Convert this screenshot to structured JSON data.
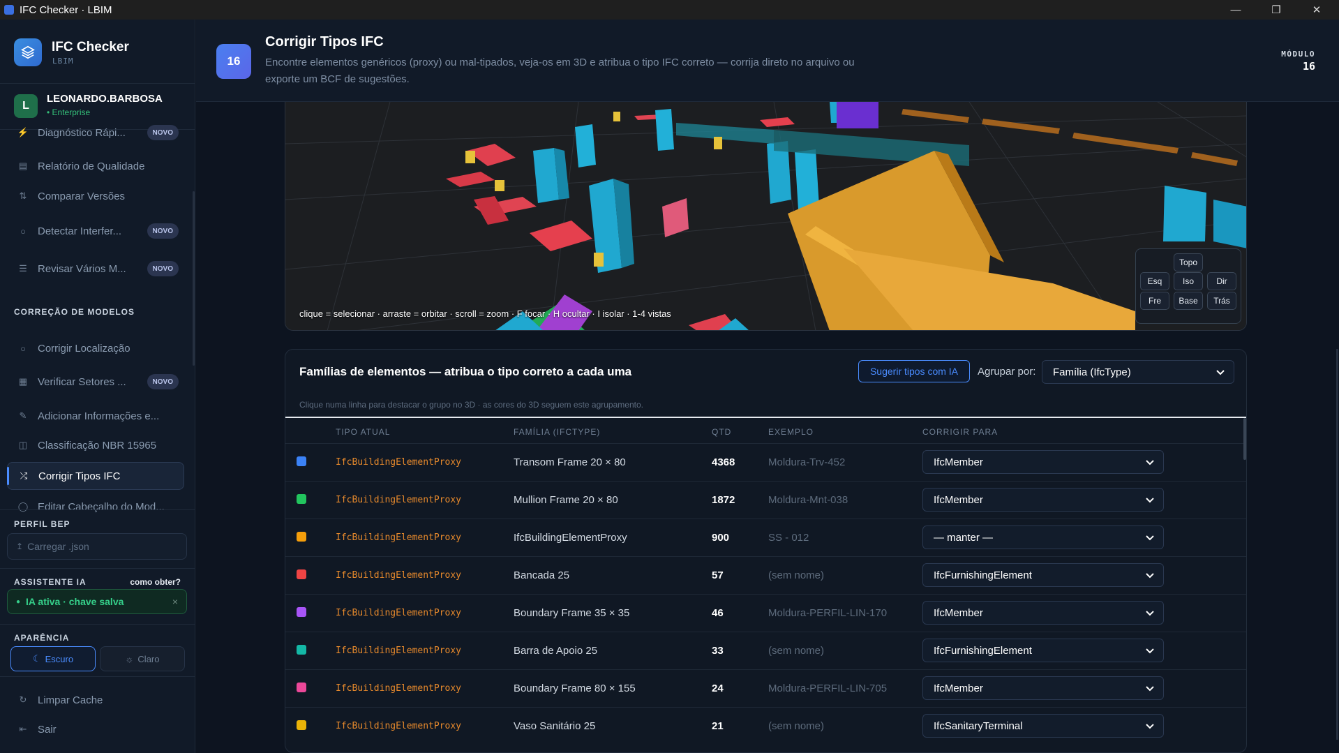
{
  "window": {
    "title": "IFC Checker · LBIM"
  },
  "brand": {
    "name": "IFC Checker",
    "sub": "LBIM"
  },
  "user": {
    "initial": "L",
    "name": "LEONARDO.BARBOSA",
    "plan": "• Enterprise"
  },
  "nav_top": [
    {
      "label": "Diagnóstico Rápi...",
      "badge": "NOVO",
      "icon": "bolt-icon"
    },
    {
      "label": "Relatório de Qualidade",
      "badge": "",
      "icon": "report-icon"
    },
    {
      "label": "Comparar Versões",
      "badge": "",
      "icon": "compare-icon"
    },
    {
      "label": "Detectar Interfer...",
      "badge": "NOVO",
      "icon": "shield-icon"
    },
    {
      "label": "Revisar Vários M...",
      "badge": "NOVO",
      "icon": "layers-icon"
    }
  ],
  "section_correcao": "CORREÇÃO DE MODELOS",
  "nav_correcao": [
    {
      "label": "Corrigir Localização",
      "badge": "",
      "icon": "shield-icon"
    },
    {
      "label": "Verificar Setores ...",
      "badge": "NOVO",
      "icon": "grid-icon"
    },
    {
      "label": "Adicionar Informações e...",
      "badge": "",
      "icon": "edit-icon"
    },
    {
      "label": "Classificação NBR 15965",
      "badge": "",
      "icon": "table-icon"
    },
    {
      "label": "Corrigir Tipos IFC",
      "badge": "",
      "icon": "shuffle-icon"
    },
    {
      "label": "Editar Cabeçalho do Mod...",
      "badge": "",
      "icon": "database-icon"
    }
  ],
  "bep": {
    "title": "PERFIL BEP",
    "upload": "Carregar .json"
  },
  "assistant": {
    "title": "ASSISTENTE IA",
    "help": "como obter?",
    "status": "IA ativa · chave salva",
    "close": "×"
  },
  "appearance": {
    "title": "APARÊNCIA",
    "dark": "Escuro",
    "light": "Claro"
  },
  "footer_nav": [
    {
      "label": "Limpar Cache"
    },
    {
      "label": "Sair"
    }
  ],
  "header": {
    "number": "16",
    "title": "Corrigir Tipos IFC",
    "description": "Encontre elementos genéricos (proxy) ou mal-tipados, veja-os em 3D e atribua o tipo IFC correto — corrija direto no arquivo ou exporte um BCF de sugestões.",
    "module_label": "MÓDULO",
    "module_number": "16"
  },
  "viewer": {
    "hint": "clique = selecionar · arraste = orbitar · scroll = zoom · F focar · H ocultar · I isolar · 1-4 vistas",
    "views": {
      "top": "Topo",
      "left": "Esq",
      "iso": "Iso",
      "right": "Dir",
      "front": "Fre",
      "base": "Base",
      "back": "Trás"
    }
  },
  "families": {
    "title": "Famílias de elementos — atribua o tipo correto a cada uma",
    "suggest": "Sugerir tipos com IA",
    "group_label": "Agrupar por:",
    "group_value": "Família (IfcType)",
    "subtitle": "Clique numa linha para destacar o grupo no 3D · as cores do 3D seguem este agrupamento.",
    "columns": {
      "type": "TIPO ATUAL",
      "family": "FAMÍLIA (IFCTYPE)",
      "qty": "QTD",
      "example": "EXEMPLO",
      "fix": "CORRIGIR PARA"
    },
    "rows": [
      {
        "color": "#3b82f6",
        "type": "IfcBuildingElementProxy",
        "family": "Transom Frame 20 × 80",
        "qty": "4368",
        "example": "Moldura-Trv-452",
        "fix": "IfcMember"
      },
      {
        "color": "#22c55e",
        "type": "IfcBuildingElementProxy",
        "family": "Mullion Frame 20 × 80",
        "qty": "1872",
        "example": "Moldura-Mnt-038",
        "fix": "IfcMember"
      },
      {
        "color": "#f59e0b",
        "type": "IfcBuildingElementProxy",
        "family": "IfcBuildingElementProxy",
        "qty": "900",
        "example": "SS - 012",
        "fix": "— manter —"
      },
      {
        "color": "#ef4444",
        "type": "IfcBuildingElementProxy",
        "family": "Bancada 25",
        "qty": "57",
        "example": "(sem nome)",
        "fix": "IfcFurnishingElement"
      },
      {
        "color": "#a855f7",
        "type": "IfcBuildingElementProxy",
        "family": "Boundary Frame 35 × 35",
        "qty": "46",
        "example": "Moldura-PERFIL-LIN-170",
        "fix": "IfcMember"
      },
      {
        "color": "#14b8a6",
        "type": "IfcBuildingElementProxy",
        "family": "Barra de Apoio 25",
        "qty": "33",
        "example": "(sem nome)",
        "fix": "IfcFurnishingElement"
      },
      {
        "color": "#ec4899",
        "type": "IfcBuildingElementProxy",
        "family": "Boundary Frame 80 × 155",
        "qty": "24",
        "example": "Moldura-PERFIL-LIN-705",
        "fix": "IfcMember"
      },
      {
        "color": "#eab308",
        "type": "IfcBuildingElementProxy",
        "family": "Vaso Sanitário 25",
        "qty": "21",
        "example": "(sem nome)",
        "fix": "IfcSanitaryTerminal"
      }
    ]
  }
}
